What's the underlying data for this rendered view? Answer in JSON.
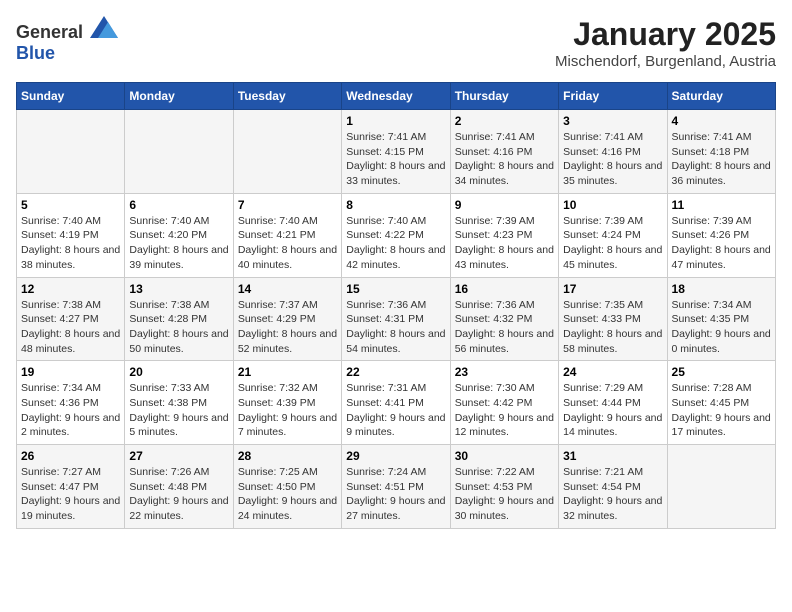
{
  "header": {
    "logo_general": "General",
    "logo_blue": "Blue",
    "month_year": "January 2025",
    "location": "Mischendorf, Burgenland, Austria"
  },
  "weekdays": [
    "Sunday",
    "Monday",
    "Tuesday",
    "Wednesday",
    "Thursday",
    "Friday",
    "Saturday"
  ],
  "weeks": [
    [
      {
        "day": "",
        "info": ""
      },
      {
        "day": "",
        "info": ""
      },
      {
        "day": "",
        "info": ""
      },
      {
        "day": "1",
        "info": "Sunrise: 7:41 AM\nSunset: 4:15 PM\nDaylight: 8 hours and 33 minutes."
      },
      {
        "day": "2",
        "info": "Sunrise: 7:41 AM\nSunset: 4:16 PM\nDaylight: 8 hours and 34 minutes."
      },
      {
        "day": "3",
        "info": "Sunrise: 7:41 AM\nSunset: 4:16 PM\nDaylight: 8 hours and 35 minutes."
      },
      {
        "day": "4",
        "info": "Sunrise: 7:41 AM\nSunset: 4:18 PM\nDaylight: 8 hours and 36 minutes."
      }
    ],
    [
      {
        "day": "5",
        "info": "Sunrise: 7:40 AM\nSunset: 4:19 PM\nDaylight: 8 hours and 38 minutes."
      },
      {
        "day": "6",
        "info": "Sunrise: 7:40 AM\nSunset: 4:20 PM\nDaylight: 8 hours and 39 minutes."
      },
      {
        "day": "7",
        "info": "Sunrise: 7:40 AM\nSunset: 4:21 PM\nDaylight: 8 hours and 40 minutes."
      },
      {
        "day": "8",
        "info": "Sunrise: 7:40 AM\nSunset: 4:22 PM\nDaylight: 8 hours and 42 minutes."
      },
      {
        "day": "9",
        "info": "Sunrise: 7:39 AM\nSunset: 4:23 PM\nDaylight: 8 hours and 43 minutes."
      },
      {
        "day": "10",
        "info": "Sunrise: 7:39 AM\nSunset: 4:24 PM\nDaylight: 8 hours and 45 minutes."
      },
      {
        "day": "11",
        "info": "Sunrise: 7:39 AM\nSunset: 4:26 PM\nDaylight: 8 hours and 47 minutes."
      }
    ],
    [
      {
        "day": "12",
        "info": "Sunrise: 7:38 AM\nSunset: 4:27 PM\nDaylight: 8 hours and 48 minutes."
      },
      {
        "day": "13",
        "info": "Sunrise: 7:38 AM\nSunset: 4:28 PM\nDaylight: 8 hours and 50 minutes."
      },
      {
        "day": "14",
        "info": "Sunrise: 7:37 AM\nSunset: 4:29 PM\nDaylight: 8 hours and 52 minutes."
      },
      {
        "day": "15",
        "info": "Sunrise: 7:36 AM\nSunset: 4:31 PM\nDaylight: 8 hours and 54 minutes."
      },
      {
        "day": "16",
        "info": "Sunrise: 7:36 AM\nSunset: 4:32 PM\nDaylight: 8 hours and 56 minutes."
      },
      {
        "day": "17",
        "info": "Sunrise: 7:35 AM\nSunset: 4:33 PM\nDaylight: 8 hours and 58 minutes."
      },
      {
        "day": "18",
        "info": "Sunrise: 7:34 AM\nSunset: 4:35 PM\nDaylight: 9 hours and 0 minutes."
      }
    ],
    [
      {
        "day": "19",
        "info": "Sunrise: 7:34 AM\nSunset: 4:36 PM\nDaylight: 9 hours and 2 minutes."
      },
      {
        "day": "20",
        "info": "Sunrise: 7:33 AM\nSunset: 4:38 PM\nDaylight: 9 hours and 5 minutes."
      },
      {
        "day": "21",
        "info": "Sunrise: 7:32 AM\nSunset: 4:39 PM\nDaylight: 9 hours and 7 minutes."
      },
      {
        "day": "22",
        "info": "Sunrise: 7:31 AM\nSunset: 4:41 PM\nDaylight: 9 hours and 9 minutes."
      },
      {
        "day": "23",
        "info": "Sunrise: 7:30 AM\nSunset: 4:42 PM\nDaylight: 9 hours and 12 minutes."
      },
      {
        "day": "24",
        "info": "Sunrise: 7:29 AM\nSunset: 4:44 PM\nDaylight: 9 hours and 14 minutes."
      },
      {
        "day": "25",
        "info": "Sunrise: 7:28 AM\nSunset: 4:45 PM\nDaylight: 9 hours and 17 minutes."
      }
    ],
    [
      {
        "day": "26",
        "info": "Sunrise: 7:27 AM\nSunset: 4:47 PM\nDaylight: 9 hours and 19 minutes."
      },
      {
        "day": "27",
        "info": "Sunrise: 7:26 AM\nSunset: 4:48 PM\nDaylight: 9 hours and 22 minutes."
      },
      {
        "day": "28",
        "info": "Sunrise: 7:25 AM\nSunset: 4:50 PM\nDaylight: 9 hours and 24 minutes."
      },
      {
        "day": "29",
        "info": "Sunrise: 7:24 AM\nSunset: 4:51 PM\nDaylight: 9 hours and 27 minutes."
      },
      {
        "day": "30",
        "info": "Sunrise: 7:22 AM\nSunset: 4:53 PM\nDaylight: 9 hours and 30 minutes."
      },
      {
        "day": "31",
        "info": "Sunrise: 7:21 AM\nSunset: 4:54 PM\nDaylight: 9 hours and 32 minutes."
      },
      {
        "day": "",
        "info": ""
      }
    ]
  ]
}
